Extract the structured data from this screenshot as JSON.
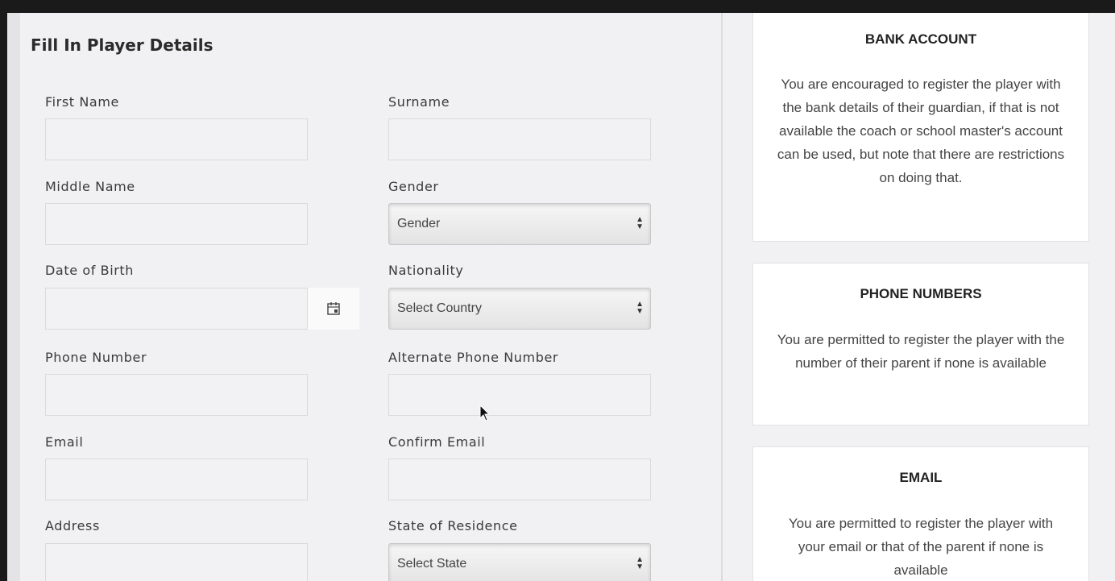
{
  "form": {
    "title": "Fill In Player Details",
    "fields": {
      "first_name": {
        "label": "First Name",
        "value": ""
      },
      "surname": {
        "label": "Surname",
        "value": ""
      },
      "middle_name": {
        "label": "Middle Name",
        "value": ""
      },
      "gender": {
        "label": "Gender",
        "selected": "Gender"
      },
      "dob": {
        "label": "Date of Birth",
        "value": "",
        "icon": "calendar-icon"
      },
      "nationality": {
        "label": "Nationality",
        "selected": "Select Country"
      },
      "phone": {
        "label": "Phone Number",
        "value": ""
      },
      "alt_phone": {
        "label": "Alternate Phone Number",
        "value": ""
      },
      "email": {
        "label": "Email",
        "value": ""
      },
      "confirm_email": {
        "label": "Confirm Email",
        "value": ""
      },
      "address": {
        "label": "Address",
        "value": ""
      },
      "state": {
        "label": "State of Residence",
        "selected": "Select State"
      }
    }
  },
  "info_cards": {
    "bank": {
      "title": "BANK ACCOUNT",
      "body": "You are encouraged to register the player with the bank details of their guardian, if that is not available the coach or school master's account can be used, but note that there are restrictions on doing that."
    },
    "phone": {
      "title": "PHONE NUMBERS",
      "body": "You are permitted to register the player with the number of their parent if none is available"
    },
    "email": {
      "title": "EMAIL",
      "body": "You are permitted to register the player with your email or that of the parent if none is available"
    }
  }
}
